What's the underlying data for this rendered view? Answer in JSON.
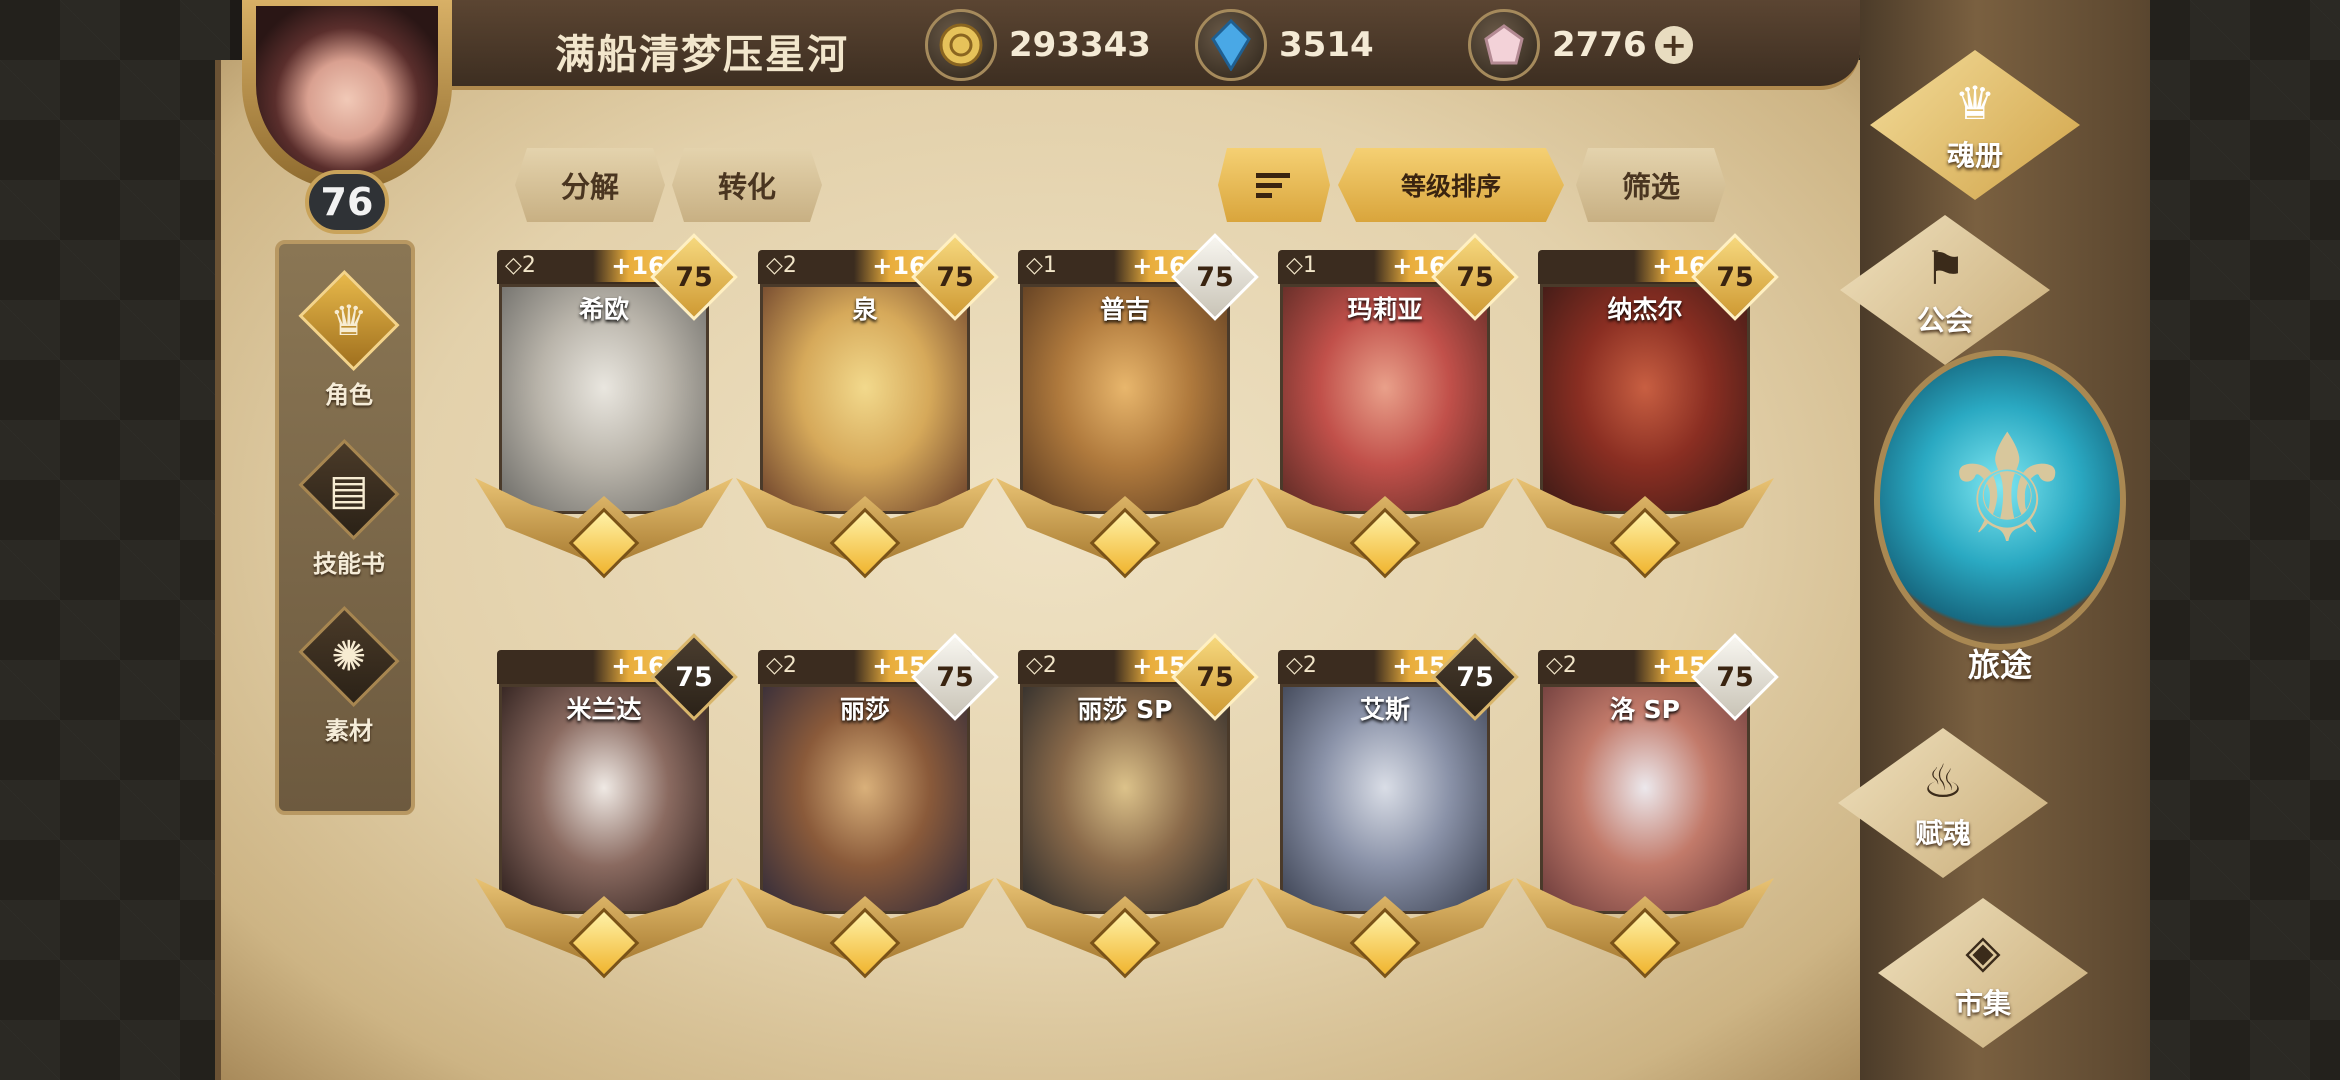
{
  "player": {
    "name": "满船清梦压星河",
    "level": "76"
  },
  "currencies": [
    {
      "icon": "gold-coin-icon",
      "value": "293343"
    },
    {
      "icon": "blue-crystal-icon",
      "value": "3514"
    },
    {
      "icon": "pink-gem-icon",
      "value": "2776",
      "plus": "+"
    }
  ],
  "left_nav": [
    {
      "label": "角色",
      "icon": "helmet-icon",
      "active": true
    },
    {
      "label": "技能书",
      "icon": "skill-book-icon",
      "active": false
    },
    {
      "label": "素材",
      "icon": "material-beast-icon",
      "active": false
    }
  ],
  "actions": {
    "decompose": "分解",
    "convert": "转化",
    "sort_icon": "sort-list-icon",
    "sort_level": "等级排序",
    "filter": "筛选"
  },
  "cards": [
    {
      "name": "希欧",
      "star": "◇2",
      "plus": "+16",
      "level": "75",
      "level_style": "gold",
      "colors": [
        "#e9e6df",
        "#b9b4aa",
        "#6b6a66"
      ]
    },
    {
      "name": "泉",
      "star": "◇2",
      "plus": "+16",
      "level": "75",
      "level_style": "gold",
      "colors": [
        "#f2d98c",
        "#d6a95a",
        "#6a3f2a"
      ]
    },
    {
      "name": "普吉",
      "star": "◇1",
      "plus": "+16",
      "level": "75",
      "level_style": "silver",
      "colors": [
        "#e8b66c",
        "#b07a3d",
        "#5a3a20"
      ]
    },
    {
      "name": "玛莉亚",
      "star": "◇1",
      "plus": "+16",
      "level": "75",
      "level_style": "gold",
      "colors": [
        "#e9a08a",
        "#c1504a",
        "#5a2a24"
      ]
    },
    {
      "name": "纳杰尔",
      "star": "",
      "plus": "+16",
      "level": "75",
      "level_style": "gold",
      "colors": [
        "#c85f42",
        "#8a2e22",
        "#3a1a16"
      ]
    },
    {
      "name": "米兰达",
      "star": "",
      "plus": "+16",
      "level": "75",
      "level_style": "dark",
      "colors": [
        "#efe9e4",
        "#8a6a60",
        "#2a1c1a"
      ]
    },
    {
      "name": "丽莎",
      "star": "◇2",
      "plus": "+15",
      "level": "75",
      "level_style": "silver",
      "colors": [
        "#d9b07a",
        "#8a5a3a",
        "#2f2a3a"
      ]
    },
    {
      "name": "丽莎 SP",
      "star": "◇2",
      "plus": "+15",
      "level": "75",
      "level_style": "gold",
      "colors": [
        "#dcc28a",
        "#8a6a4a",
        "#2a2a2a"
      ]
    },
    {
      "name": "艾斯",
      "star": "◇2",
      "plus": "+15",
      "level": "75",
      "level_style": "dark",
      "colors": [
        "#d9dde6",
        "#8a92a8",
        "#3a4050"
      ]
    },
    {
      "name": "洛 SP",
      "star": "◇2",
      "plus": "+15",
      "level": "75",
      "level_style": "silver",
      "colors": [
        "#ece8ec",
        "#c27a6a",
        "#6a3a3a"
      ]
    }
  ],
  "right_menu": [
    {
      "label": "魂册",
      "icon": "helmet-icon",
      "active": true
    },
    {
      "label": "公会",
      "icon": "guild-banner-icon",
      "active": false
    },
    {
      "label": "赋魂",
      "icon": "soul-flame-icon",
      "active": false
    },
    {
      "label": "市集",
      "icon": "gem-market-icon",
      "active": false
    }
  ],
  "journey": {
    "label": "旅途",
    "icon": "journey-emblem-icon"
  }
}
